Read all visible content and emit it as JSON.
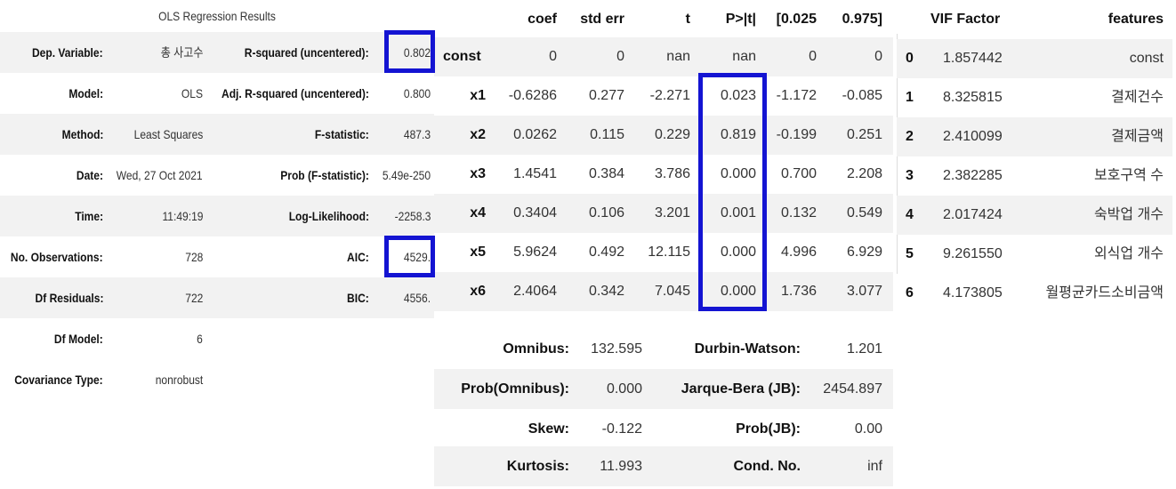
{
  "ols": {
    "caption": "OLS Regression Results",
    "rows": [
      {
        "k1": "Dep. Variable:",
        "v1": "총 사고수",
        "k2": "R-squared (uncentered):",
        "v2": "0.802"
      },
      {
        "k1": "Model:",
        "v1": "OLS",
        "k2": "Adj. R-squared (uncentered):",
        "v2": "0.800"
      },
      {
        "k1": "Method:",
        "v1": "Least Squares",
        "k2": "F-statistic:",
        "v2": "487.3"
      },
      {
        "k1": "Date:",
        "v1": "Wed, 27 Oct 2021",
        "k2": "Prob (F-statistic):",
        "v2": "5.49e-250"
      },
      {
        "k1": "Time:",
        "v1": "11:49:19",
        "k2": "Log-Likelihood:",
        "v2": "-2258.3"
      },
      {
        "k1": "No. Observations:",
        "v1": "728",
        "k2": "AIC:",
        "v2": "4529."
      },
      {
        "k1": "Df Residuals:",
        "v1": "722",
        "k2": "BIC:",
        "v2": "4556."
      },
      {
        "k1": "Df Model:",
        "v1": "6",
        "k2": "",
        "v2": ""
      },
      {
        "k1": "Covariance Type:",
        "v1": "nonrobust",
        "k2": "",
        "v2": ""
      }
    ]
  },
  "coef": {
    "headers": [
      "coef",
      "std err",
      "t",
      "P>|t|",
      "[0.025",
      "0.975]"
    ],
    "rows": [
      {
        "label": "const",
        "vals": [
          "0",
          "0",
          "nan",
          "nan",
          "0",
          "0"
        ]
      },
      {
        "label": "x1",
        "vals": [
          "-0.6286",
          "0.277",
          "-2.271",
          "0.023",
          "-1.172",
          "-0.085"
        ]
      },
      {
        "label": "x2",
        "vals": [
          "0.0262",
          "0.115",
          "0.229",
          "0.819",
          "-0.199",
          "0.251"
        ]
      },
      {
        "label": "x3",
        "vals": [
          "1.4541",
          "0.384",
          "3.786",
          "0.000",
          "0.700",
          "2.208"
        ]
      },
      {
        "label": "x4",
        "vals": [
          "0.3404",
          "0.106",
          "3.201",
          "0.001",
          "0.132",
          "0.549"
        ]
      },
      {
        "label": "x5",
        "vals": [
          "5.9624",
          "0.492",
          "12.115",
          "0.000",
          "4.996",
          "6.929"
        ]
      },
      {
        "label": "x6",
        "vals": [
          "2.4064",
          "0.342",
          "7.045",
          "0.000",
          "1.736",
          "3.077"
        ]
      }
    ]
  },
  "diag": {
    "rows": [
      {
        "k1": "Omnibus:",
        "v1": "132.595",
        "k2": "Durbin-Watson:",
        "v2": "1.201"
      },
      {
        "k1": "Prob(Omnibus):",
        "v1": "0.000",
        "k2": "Jarque-Bera (JB):",
        "v2": "2454.897"
      },
      {
        "k1": "Skew:",
        "v1": "-0.122",
        "k2": "Prob(JB):",
        "v2": "0.00"
      },
      {
        "k1": "Kurtosis:",
        "v1": "11.993",
        "k2": "Cond. No.",
        "v2": "inf"
      }
    ]
  },
  "vif": {
    "headers": [
      "VIF Factor",
      "features"
    ],
    "rows": [
      {
        "idx": "0",
        "val": "1.857442",
        "feat": "const"
      },
      {
        "idx": "1",
        "val": "8.325815",
        "feat": "결제건수"
      },
      {
        "idx": "2",
        "val": "2.410099",
        "feat": "결제금액"
      },
      {
        "idx": "3",
        "val": "2.382285",
        "feat": "보호구역 수"
      },
      {
        "idx": "4",
        "val": "2.017424",
        "feat": "숙박업 개수"
      },
      {
        "idx": "5",
        "val": "9.261550",
        "feat": "외식업 개수"
      },
      {
        "idx": "6",
        "val": "4.173805",
        "feat": "월평균카드소비금액"
      }
    ]
  },
  "highlight_color": "#1414d2"
}
